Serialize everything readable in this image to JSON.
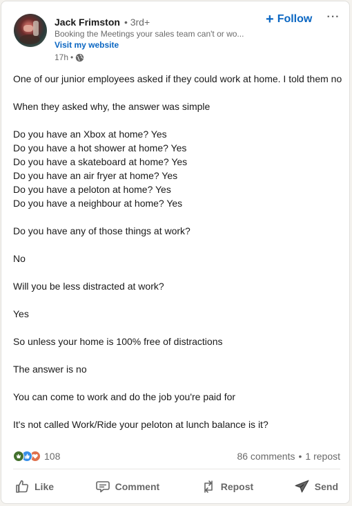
{
  "author": {
    "name": "Jack Frimston",
    "degree": "• 3rd+",
    "headline": "Booking the Meetings your sales team can't or wo...",
    "website_label": "Visit my website",
    "time": "17h",
    "time_sep": "•",
    "visibility_icon": "globe-icon"
  },
  "header": {
    "follow_label": "Follow",
    "follow_icon": "+",
    "more_icon": "···"
  },
  "post": {
    "paragraphs": [
      [
        "One of our junior employees asked if they could work at home. I told them no"
      ],
      [
        "When they asked why, the answer was simple"
      ],
      [
        "Do you have an Xbox at home? Yes",
        "Do you have a hot shower at home? Yes",
        "Do you have a skateboard at home? Yes",
        "Do you have an air fryer at home? Yes",
        "Do you have a peloton at home? Yes",
        "Do you have a neighbour at home? Yes"
      ],
      [
        "Do you have any of those things at work?"
      ],
      [
        "No"
      ],
      [
        "Will you be less distracted at work?"
      ],
      [
        "Yes"
      ],
      [
        "So unless your home is 100% free of distractions"
      ],
      [
        "The answer is no"
      ],
      [
        "You can come to work and do the job you're paid for"
      ],
      [
        "It's not called Work/Ride your peloton at lunch balance is it?"
      ]
    ]
  },
  "social": {
    "reaction_icons": [
      "clap-icon",
      "like-icon",
      "love-icon"
    ],
    "reactions_count": "108",
    "comments": "86 comments",
    "separator": "•",
    "reposts": "1 repost"
  },
  "actions": [
    {
      "label": "Like",
      "icon": "thumbs-up-icon"
    },
    {
      "label": "Comment",
      "icon": "comment-icon"
    },
    {
      "label": "Repost",
      "icon": "repost-icon"
    },
    {
      "label": "Send",
      "icon": "send-icon"
    }
  ],
  "colors": {
    "accent": "#0a66c2",
    "muted_text": "#666666",
    "reaction_clap": "#44712e",
    "reaction_like": "#378fe9",
    "reaction_love": "#df704d"
  }
}
